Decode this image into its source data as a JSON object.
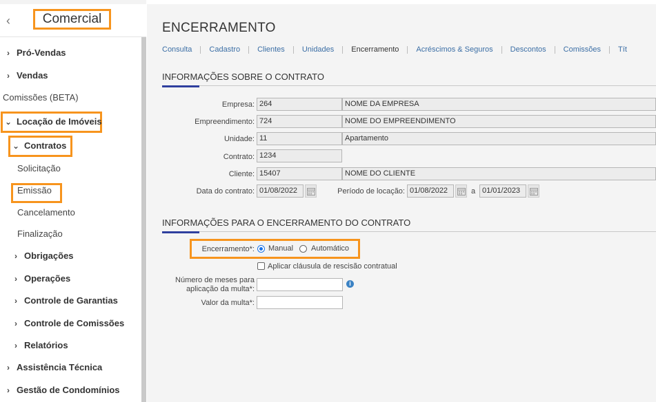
{
  "sidebar": {
    "title": "Comercial",
    "items": [
      {
        "label": "Pró-Vendas"
      },
      {
        "label": "Vendas"
      },
      {
        "label": "Comissões (BETA)"
      },
      {
        "label": "Locação de Imóveis"
      },
      {
        "label": "Contratos"
      },
      {
        "label": "Solicitação"
      },
      {
        "label": "Emissão"
      },
      {
        "label": "Cancelamento"
      },
      {
        "label": "Finalização"
      },
      {
        "label": "Obrigações"
      },
      {
        "label": "Operações"
      },
      {
        "label": "Controle de Garantias"
      },
      {
        "label": "Controle de Comissões"
      },
      {
        "label": "Relatórios"
      },
      {
        "label": "Assistência Técnica"
      },
      {
        "label": "Gestão de Condomínios"
      }
    ]
  },
  "page": {
    "title": "ENCERRAMENTO",
    "tabs": [
      "Consulta",
      "Cadastro",
      "Clientes",
      "Unidades",
      "Encerramento",
      "Acréscimos & Seguros",
      "Descontos",
      "Comissões",
      "Tít"
    ]
  },
  "contract_info": {
    "section_title": "INFORMAÇÕES SOBRE O CONTRATO",
    "empresa_label": "Empresa:",
    "empresa_code": "264",
    "empresa_name": "NOME DA EMPRESA",
    "empreendimento_label": "Empreendimento:",
    "empreendimento_code": "724",
    "empreendimento_name": "NOME DO EMPREENDIMENTO",
    "unidade_label": "Unidade:",
    "unidade_code": "11",
    "unidade_name": "Apartamento",
    "contrato_label": "Contrato:",
    "contrato_value": "1234",
    "cliente_label": "Cliente:",
    "cliente_code": "15407",
    "cliente_name": "NOME DO CLIENTE",
    "data_label": "Data do contrato:",
    "data_value": "01/08/2022",
    "periodo_label": "Período de locação:",
    "periodo_start": "01/08/2022",
    "periodo_sep": "a",
    "periodo_end": "01/01/2023"
  },
  "closing_info": {
    "section_title": "INFORMAÇÕES PARA O ENCERRAMENTO DO CONTRATO",
    "encerramento_label": "Encerramento*:",
    "option_manual": "Manual",
    "option_auto": "Automático",
    "selected": "Manual",
    "clause_label": "Aplicar cláusula de rescisão contratual",
    "meses_label_1": "Número de meses para",
    "meses_label_2": "aplicação da multa*:",
    "multa_label": "Valor da multa*:"
  },
  "colors": {
    "highlight": "#f7941d",
    "accent": "#2f3f9e",
    "link": "#3b6ea5"
  }
}
